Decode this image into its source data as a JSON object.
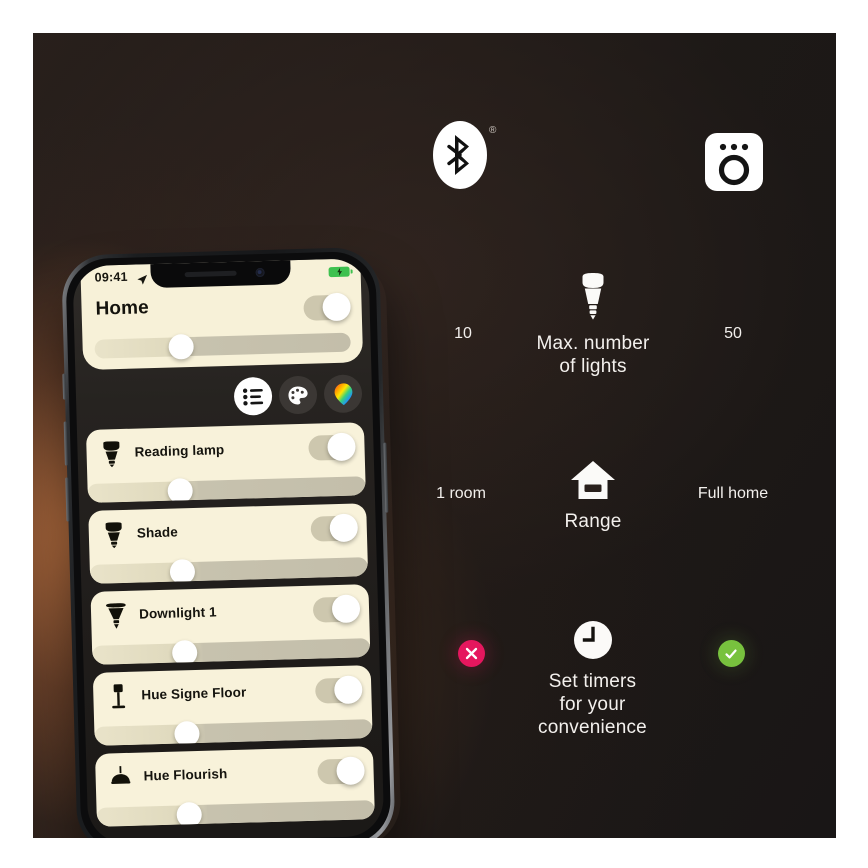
{
  "scene": {
    "title": "Philips Hue Bluetooth vs Bridge comparison",
    "background_colors": {
      "glow": "#c47642",
      "dark": "#1d1917",
      "near_black": "#191616"
    }
  },
  "hero": {
    "left_icon_name": "bluetooth-icon",
    "left_icon_trademark": "®",
    "right_icon_name": "hue-bridge-icon"
  },
  "comparison": {
    "rows": [
      {
        "icon": "light-bulb-icon",
        "label": "Max. number\nof lights",
        "label_line1": "Max. number",
        "label_line2": "of lights",
        "left_value": "10",
        "right_value": "50"
      },
      {
        "icon": "home-range-icon",
        "label": "Range",
        "left_value": "1 room",
        "right_value": "Full home"
      },
      {
        "icon": "clock-timer-icon",
        "label_line1": "Set timers",
        "label_line2": "for your",
        "label_line3": "convenience",
        "left_value": "",
        "right_value": "",
        "left_badge": "cross-badge",
        "right_badge": "check-badge",
        "left_badge_glyph": "✕",
        "right_badge_glyph": "✓",
        "left_badge_color": "#e5175e",
        "right_badge_color": "#78c23e"
      }
    ]
  },
  "phone": {
    "status_bar": {
      "time": "09:41",
      "location_icon": "location-arrow-icon",
      "battery_icon": "battery-charging-icon",
      "battery_glyph": "⚡"
    },
    "home_card": {
      "title": "Home",
      "toggle_name": "home-master-toggle",
      "toggle_state": "on",
      "slider_name": "home-brightness-slider",
      "slider_percent": 33
    },
    "tabs": [
      {
        "id": "list",
        "icon": "list-icon",
        "active": true
      },
      {
        "id": "scenes",
        "icon": "palette-icon",
        "active": false
      },
      {
        "id": "color",
        "icon": "color-picker-icon",
        "active": false
      }
    ],
    "lights": [
      {
        "name": "Reading lamp",
        "icon": "spot-bulb-icon",
        "toggle_state": "on",
        "slider_percent": 33
      },
      {
        "name": "Shade",
        "icon": "spot-bulb-icon",
        "toggle_state": "on",
        "slider_percent": 33
      },
      {
        "name": "Downlight 1",
        "icon": "downlight-icon",
        "toggle_state": "on",
        "slider_percent": 33
      },
      {
        "name": "Hue Signe Floor",
        "icon": "floor-lamp-icon",
        "toggle_state": "on",
        "slider_percent": 33
      },
      {
        "name": "Hue Flourish",
        "icon": "pendant-lamp-icon",
        "toggle_state": "on",
        "slider_percent": 33
      }
    ]
  }
}
